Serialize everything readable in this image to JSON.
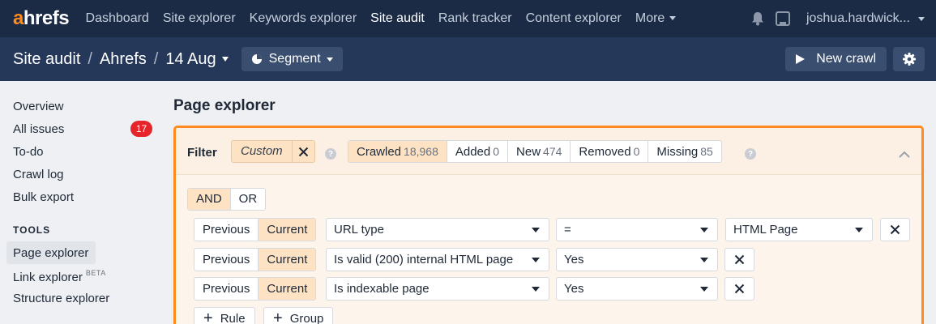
{
  "nav": {
    "logo_a": "a",
    "logo_rest": "hrefs",
    "items": [
      {
        "label": "Dashboard"
      },
      {
        "label": "Site explorer"
      },
      {
        "label": "Keywords explorer"
      },
      {
        "label": "Site audit"
      },
      {
        "label": "Rank tracker"
      },
      {
        "label": "Content explorer"
      },
      {
        "label": "More"
      }
    ],
    "active_item": "Site audit",
    "user": "joshua.hardwick..."
  },
  "subheader": {
    "crumbs": [
      "Site audit",
      "Ahrefs",
      "14 Aug"
    ],
    "separator": "/",
    "segment_label": "Segment",
    "new_crawl_label": "New crawl"
  },
  "sidebar": {
    "items": [
      {
        "label": "Overview"
      },
      {
        "label": "All issues",
        "badge": "17"
      },
      {
        "label": "To-do"
      },
      {
        "label": "Crawl log"
      },
      {
        "label": "Bulk export"
      }
    ],
    "section_title": "TOOLS",
    "tools": [
      {
        "label": "Page explorer"
      },
      {
        "label": "Link explorer",
        "tag": "BETA"
      },
      {
        "label": "Structure explorer"
      }
    ],
    "active_tool": "Page explorer"
  },
  "main": {
    "title": "Page explorer",
    "filter": {
      "label": "Filter",
      "custom_label": "Custom",
      "help": "?",
      "tabs": [
        {
          "label": "Crawled",
          "count": "18,968"
        },
        {
          "label": "Added",
          "count": "0"
        },
        {
          "label": "New",
          "count": "474"
        },
        {
          "label": "Removed",
          "count": "0"
        },
        {
          "label": "Missing",
          "count": "85"
        }
      ],
      "active_tab": "Crawled"
    },
    "logic": {
      "and": "AND",
      "or": "OR",
      "active": "AND"
    },
    "rules": [
      {
        "prev": "Previous",
        "curr": "Current",
        "field": "URL type",
        "operator": "=",
        "value": "HTML Page"
      },
      {
        "prev": "Previous",
        "curr": "Current",
        "field": "Is valid (200) internal HTML page",
        "value": "Yes"
      },
      {
        "prev": "Previous",
        "curr": "Current",
        "field": "Is indexable page",
        "value": "Yes"
      }
    ],
    "add_rule": "Rule",
    "add_group": "Group"
  },
  "colors": {
    "nav_bg": "#1c2b45",
    "subheader_bg": "#25385a",
    "accent": "#ff8b1f",
    "badge": "#e5252a",
    "chip_active": "#fde2c4"
  }
}
